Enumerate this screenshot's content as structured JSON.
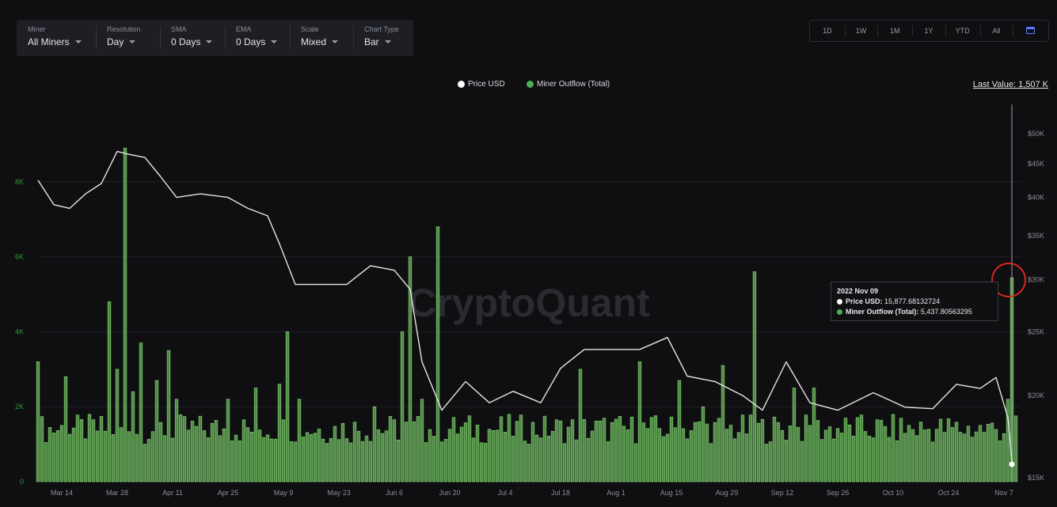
{
  "controls": [
    {
      "label": "Miner",
      "value": "All Miners"
    },
    {
      "label": "Resolution",
      "value": "Day"
    },
    {
      "label": "SMA",
      "value": "0 Days"
    },
    {
      "label": "EMA",
      "value": "0 Days"
    },
    {
      "label": "Scale",
      "value": "Mixed"
    },
    {
      "label": "Chart Type",
      "value": "Bar"
    }
  ],
  "ranges": [
    "1D",
    "1W",
    "1M",
    "1Y",
    "YTD",
    "All"
  ],
  "calendar_icon": "calendar-icon",
  "legend": {
    "price": "Price USD",
    "outflow": "Miner Outflow (Total)",
    "last_value": "Last Value: 1,507 K"
  },
  "watermark": "CryptoQuant",
  "tooltip": {
    "date": "2022 Nov 09",
    "price_label": "Price USD:",
    "price_value": "15,877.68132724",
    "outflow_label": "Miner Outflow (Total):",
    "outflow_value": "5,437.80563295"
  },
  "colors": {
    "background": "#0f0f11",
    "price_line": "#e6e6e6",
    "bar_fill": "#4f8a44",
    "bar_stroke": "#8fdc7f",
    "left_axis": "#2f9a3a",
    "highlight_circle": "#d8281f"
  },
  "chart_data": {
    "type": "bar",
    "date_range": [
      "2022-03-08",
      "2022-11-10"
    ],
    "left_axis": {
      "ticks": [
        "0",
        "2K",
        "4K",
        "6K",
        "8K"
      ],
      "values": [
        0,
        2000,
        4000,
        6000,
        8000
      ],
      "ylim": [
        0,
        10000
      ]
    },
    "right_axis": {
      "ticks": [
        "$15K",
        "$20K",
        "$25K",
        "$30K",
        "$35K",
        "$40K",
        "$45K",
        "$50K"
      ],
      "values": [
        15000,
        20000,
        25000,
        30000,
        35000,
        40000,
        45000,
        50000
      ],
      "scale": "log"
    },
    "x_ticks": [
      {
        "label": "Mar 14",
        "date": "2022-03-14"
      },
      {
        "label": "Mar 28",
        "date": "2022-03-28"
      },
      {
        "label": "Apr 11",
        "date": "2022-04-11"
      },
      {
        "label": "Apr 25",
        "date": "2022-04-25"
      },
      {
        "label": "May 9",
        "date": "2022-05-09"
      },
      {
        "label": "May 23",
        "date": "2022-05-23"
      },
      {
        "label": "Jun 6",
        "date": "2022-06-06"
      },
      {
        "label": "Jun 20",
        "date": "2022-06-20"
      },
      {
        "label": "Jul 4",
        "date": "2022-07-04"
      },
      {
        "label": "Jul 18",
        "date": "2022-07-18"
      },
      {
        "label": "Aug 1",
        "date": "2022-08-01"
      },
      {
        "label": "Aug 15",
        "date": "2022-08-15"
      },
      {
        "label": "Aug 29",
        "date": "2022-08-29"
      },
      {
        "label": "Sep 12",
        "date": "2022-09-12"
      },
      {
        "label": "Sep 26",
        "date": "2022-09-26"
      },
      {
        "label": "Oct 10",
        "date": "2022-10-10"
      },
      {
        "label": "Oct 24",
        "date": "2022-10-24"
      },
      {
        "label": "Nov 7",
        "date": "2022-11-07"
      }
    ],
    "series": [
      {
        "name": "Miner Outflow (Total)",
        "axis": "left",
        "kind": "bar",
        "points": [
          [
            "2022-03-08",
            3200
          ],
          [
            "2022-03-15",
            2800
          ],
          [
            "2022-03-26",
            4800
          ],
          [
            "2022-03-28",
            3000
          ],
          [
            "2022-03-30",
            8900
          ],
          [
            "2022-04-01",
            2400
          ],
          [
            "2022-04-03",
            3700
          ],
          [
            "2022-04-07",
            2700
          ],
          [
            "2022-04-10",
            3500
          ],
          [
            "2022-04-12",
            2200
          ],
          [
            "2022-04-25",
            2200
          ],
          [
            "2022-05-02",
            2500
          ],
          [
            "2022-05-08",
            2600
          ],
          [
            "2022-05-10",
            4000
          ],
          [
            "2022-05-13",
            2200
          ],
          [
            "2022-06-01",
            2000
          ],
          [
            "2022-06-08",
            4000
          ],
          [
            "2022-06-10",
            6000
          ],
          [
            "2022-06-13",
            2200
          ],
          [
            "2022-06-17",
            6800
          ],
          [
            "2022-07-23",
            3000
          ],
          [
            "2022-08-07",
            3200
          ],
          [
            "2022-08-17",
            2700
          ],
          [
            "2022-08-23",
            2000
          ],
          [
            "2022-08-28",
            3100
          ],
          [
            "2022-09-05",
            5600
          ],
          [
            "2022-09-15",
            2500
          ],
          [
            "2022-09-20",
            2500
          ],
          [
            "2022-11-08",
            2200
          ],
          [
            "2022-11-09",
            5438
          ]
        ],
        "note_baseline_range": [
          1000,
          1800
        ]
      },
      {
        "name": "Price USD",
        "axis": "right",
        "kind": "line",
        "points": [
          [
            "2022-03-08",
            42500
          ],
          [
            "2022-03-12",
            39000
          ],
          [
            "2022-03-16",
            38500
          ],
          [
            "2022-03-20",
            40500
          ],
          [
            "2022-03-24",
            42000
          ],
          [
            "2022-03-28",
            47000
          ],
          [
            "2022-03-31",
            46500
          ],
          [
            "2022-04-04",
            46000
          ],
          [
            "2022-04-08",
            43000
          ],
          [
            "2022-04-12",
            40000
          ],
          [
            "2022-04-18",
            40500
          ],
          [
            "2022-04-25",
            40000
          ],
          [
            "2022-04-30",
            38500
          ],
          [
            "2022-05-05",
            37500
          ],
          [
            "2022-05-08",
            34000
          ],
          [
            "2022-05-12",
            29500
          ],
          [
            "2022-05-18",
            29500
          ],
          [
            "2022-05-25",
            29500
          ],
          [
            "2022-05-31",
            31500
          ],
          [
            "2022-06-06",
            31000
          ],
          [
            "2022-06-10",
            29000
          ],
          [
            "2022-06-13",
            22500
          ],
          [
            "2022-06-18",
            19000
          ],
          [
            "2022-06-24",
            21000
          ],
          [
            "2022-06-30",
            19500
          ],
          [
            "2022-07-06",
            20300
          ],
          [
            "2022-07-13",
            19500
          ],
          [
            "2022-07-18",
            22000
          ],
          [
            "2022-07-24",
            23500
          ],
          [
            "2022-07-31",
            23500
          ],
          [
            "2022-08-07",
            23500
          ],
          [
            "2022-08-14",
            24500
          ],
          [
            "2022-08-19",
            21400
          ],
          [
            "2022-08-26",
            21000
          ],
          [
            "2022-09-02",
            20000
          ],
          [
            "2022-09-07",
            19000
          ],
          [
            "2022-09-13",
            22500
          ],
          [
            "2022-09-19",
            19500
          ],
          [
            "2022-09-26",
            19000
          ],
          [
            "2022-10-05",
            20200
          ],
          [
            "2022-10-13",
            19200
          ],
          [
            "2022-10-20",
            19100
          ],
          [
            "2022-10-26",
            20800
          ],
          [
            "2022-11-01",
            20500
          ],
          [
            "2022-11-05",
            21300
          ],
          [
            "2022-11-08",
            18500
          ],
          [
            "2022-11-09",
            15878
          ]
        ]
      }
    ]
  }
}
